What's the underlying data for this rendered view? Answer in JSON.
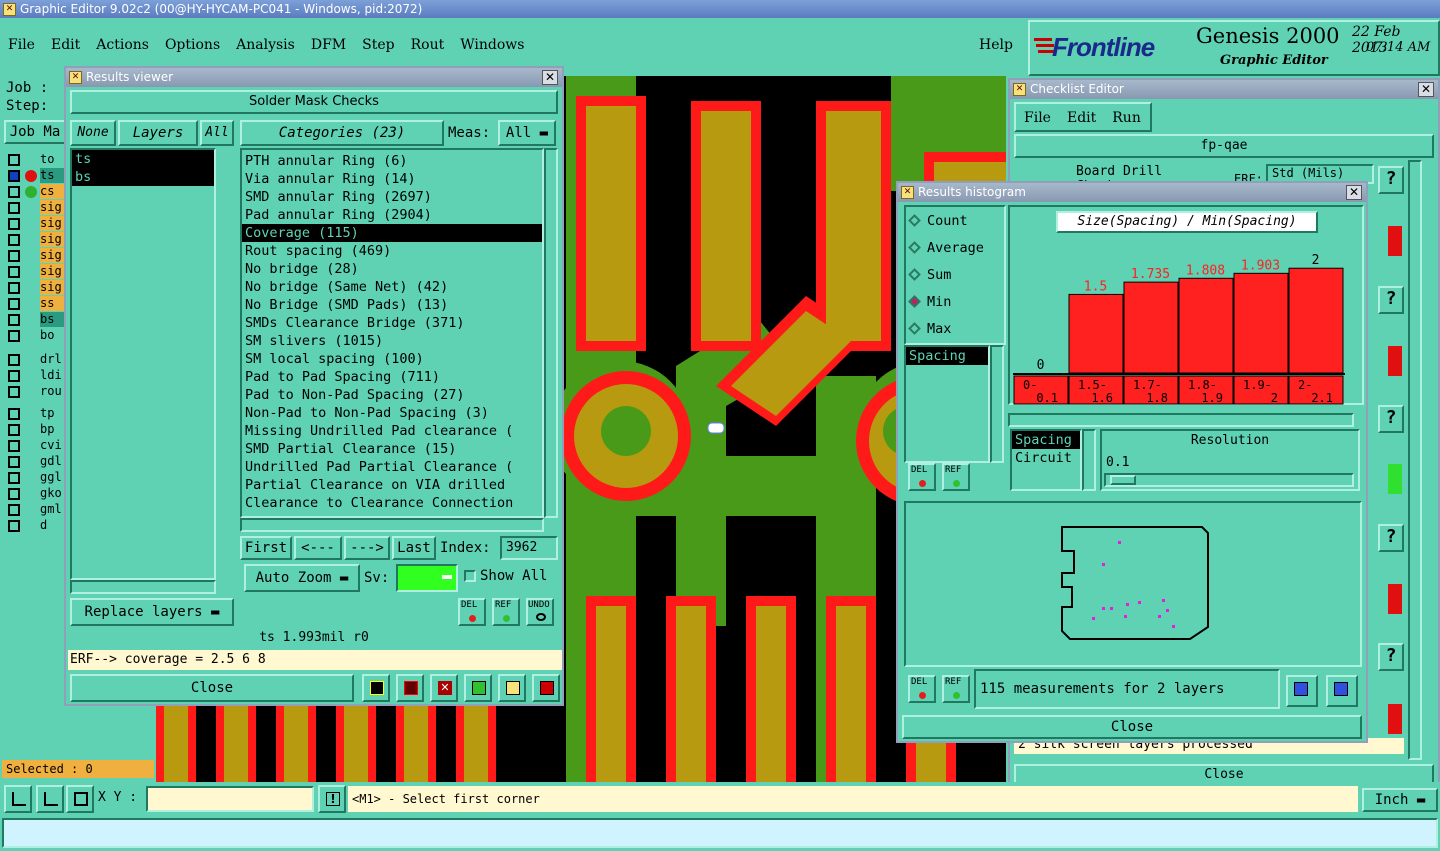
{
  "app_title": "Graphic Editor 9.02c2 (00@HY-HYCAM-PC041 - Windows, pid:2072)",
  "menu": [
    "File",
    "Edit",
    "Actions",
    "Options",
    "Analysis",
    "DFM",
    "Step",
    "Rout",
    "Windows"
  ],
  "help_label": "Help",
  "brand": {
    "logo": "Frontline",
    "product": "Genesis 2000",
    "subtitle": "Graphic Editor",
    "date": "22 Feb 2013",
    "time": "07:14 AM"
  },
  "left": {
    "job_label": "Job :",
    "step_label": "Step:",
    "job_button": "Job Ma",
    "layers": [
      {
        "name": "to",
        "color": "#5fd2b4"
      },
      {
        "name": "ts",
        "color": "#2a9a80"
      },
      {
        "name": "cs",
        "color": "#f0b040"
      },
      {
        "name": "sig",
        "color": "#f0b040"
      },
      {
        "name": "sig",
        "color": "#f0b040"
      },
      {
        "name": "sig",
        "color": "#f0b040"
      },
      {
        "name": "sig",
        "color": "#f0b040"
      },
      {
        "name": "sig",
        "color": "#f0b040"
      },
      {
        "name": "sig",
        "color": "#f0b040"
      },
      {
        "name": "ss",
        "color": "#f0b040"
      },
      {
        "name": "bs",
        "color": "#2a9a80"
      },
      {
        "name": "bo",
        "color": "#5fd2b4"
      },
      {
        "name": "drl",
        "color": "#5fd2b4"
      },
      {
        "name": "ldi",
        "color": "#5fd2b4"
      },
      {
        "name": "rou",
        "color": "#5fd2b4"
      },
      {
        "name": "tp",
        "color": "#5fd2b4"
      },
      {
        "name": "bp",
        "color": "#5fd2b4"
      },
      {
        "name": "cvi",
        "color": "#5fd2b4"
      },
      {
        "name": "gdl",
        "color": "#5fd2b4"
      },
      {
        "name": "ggl",
        "color": "#5fd2b4"
      },
      {
        "name": "gko",
        "color": "#5fd2b4"
      },
      {
        "name": "gml",
        "color": "#5fd2b4"
      },
      {
        "name": "d",
        "color": "#5fd2b4"
      }
    ],
    "selected": "Selected : 0"
  },
  "results_viewer": {
    "title": "Results viewer",
    "header": "Solder Mask Checks",
    "none_btn": "None",
    "layers_btn": "Layers",
    "all_btn": "All",
    "layers": [
      "ts",
      "bs"
    ],
    "categories_btn": "Categories (23)",
    "meas_label": "Meas:",
    "meas_value": "All",
    "categories": [
      "PTH annular Ring (6)",
      "Via annular Ring (14)",
      "SMD annular Ring (2697)",
      "Pad annular Ring (2904)",
      "Coverage (115)",
      "Rout spacing (469)",
      "No bridge (28)",
      "No bridge (Same Net) (42)",
      "No Bridge (SMD Pads) (13)",
      "SMDs Clearance Bridge (371)",
      "SM slivers (1015)",
      "SM local spacing (100)",
      "Pad to Pad Spacing (711)",
      "Pad to Non-Pad Spacing (27)",
      "Non-Pad to Non-Pad Spacing (3)",
      "Missing Undrilled Pad clearance (",
      "SMD Partial Clearance (15)",
      "Undrilled Pad Partial Clearance (",
      "Partial Clearance on VIA drilled",
      "Clearance to Clearance Connection"
    ],
    "selected_category": 4,
    "first_btn": "First",
    "prev_btn": "<---",
    "next_btn": "--->",
    "last_btn": "Last",
    "index_label": "Index:",
    "index_value": "3962",
    "replace_layers": "Replace layers",
    "auto_zoom": "Auto Zoom",
    "sv_label": "Sv:",
    "show_all": "Show All",
    "del_label": "DEL",
    "ref_label": "REF",
    "undo_label": "UNDO",
    "status": "ts 1.993mil  r0",
    "erf": "ERF--> coverage = 2.5 6 8",
    "close": "Close"
  },
  "checklist": {
    "title": "Checklist Editor",
    "menu": [
      "File",
      "Edit",
      "Run"
    ],
    "name": "fp-qae",
    "row_text": "Board Drill Checks",
    "erf": "ERF:",
    "std": "Std (Mils)",
    "silk": "2 silk screen layers processed",
    "close": "Close"
  },
  "histogram": {
    "title": "Results histogram",
    "options": [
      "Count",
      "Average",
      "Sum",
      "Min",
      "Max"
    ],
    "selected_option": 3,
    "chart_title": "Size(Spacing) / Min(Spacing)",
    "list": [
      "Spacing"
    ],
    "list2": [
      "Spacing",
      "Circuit"
    ],
    "resolution_label": "Resolution",
    "resolution_value": "0.1",
    "summary": "115 measurements for 2 layers",
    "close": "Close",
    "del_label": "DEL",
    "ref_label": "REF"
  },
  "chart_data": {
    "type": "bar",
    "title": "Size(Spacing) / Min(Spacing)",
    "categories": [
      "0-0.1",
      "1.5-1.6",
      "1.7-1.8",
      "1.8-1.9",
      "1.9-2",
      "2-2.1"
    ],
    "values": [
      0,
      1.5,
      1.735,
      1.808,
      1.903,
      2
    ],
    "labels": [
      "0",
      "1.5",
      "1.735",
      "1.808",
      "1.903",
      "2"
    ],
    "ylim": [
      0,
      2.1
    ]
  },
  "bottom": {
    "xy_label": "X Y :",
    "xy_value": "",
    "prompt": "<M1> - Select first corner",
    "units": "Inch"
  },
  "colors": {
    "teal": "#5fd2b4",
    "copper": "#c8a000",
    "mask": "#ff1a1a",
    "green": "#4a9a1a",
    "black": "#000000",
    "bar": "#ff2020"
  }
}
